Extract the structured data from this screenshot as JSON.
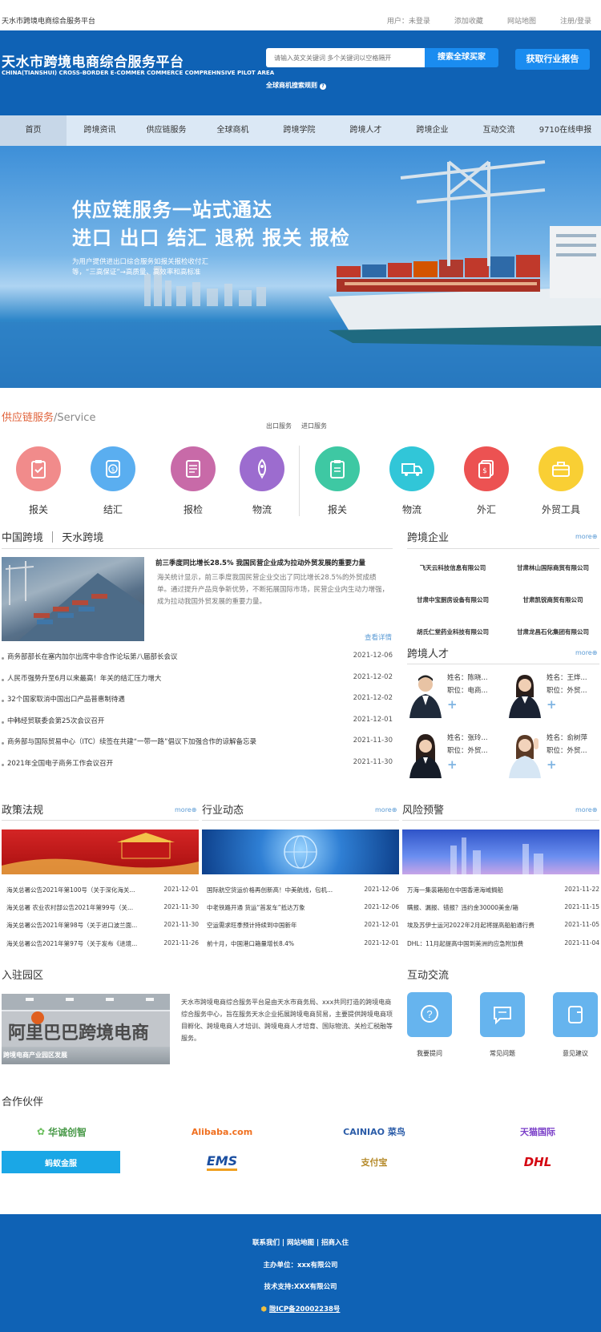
{
  "topbar": {
    "site_name": "天水市跨境电商综合服务平台",
    "links": [
      "用户：未登录",
      "添加收藏",
      "网站地图",
      "注册/登录"
    ]
  },
  "header": {
    "title": "天水市跨境电商综合服务平台",
    "subtitle": "CHINA(TIANSHUI) CROSS-BORDER E-COMMER COMMERCE COMPREHNSIVE PILOT AREA",
    "search_placeholder": "请输入英文关键词 多个关键词以空格隔开",
    "search_button": "搜索全球买家",
    "report_button": "获取行业报告",
    "search_rules": "全球商机搜索规则"
  },
  "nav": [
    "首页",
    "跨境资讯",
    "供应链服务",
    "全球商机",
    "跨境学院",
    "跨境人才",
    "跨境企业",
    "互动交流",
    "9710在线申报"
  ],
  "banner": {
    "title1": "供应链服务一站式通达",
    "title2": "进口 出口 结汇 退税 报关 报检",
    "subtitle": "为用户提供进出口综合服务如报关报检收付汇等，“三高保证”→高质量、高效率和高标准"
  },
  "service": {
    "title": "供应链服务",
    "title_en": "/Service",
    "tabs": [
      "出口服务",
      "进口服务"
    ],
    "items": [
      {
        "label": "报关",
        "color": "#f18b8b",
        "icon": "clipboard-icon"
      },
      {
        "label": "结汇",
        "color": "#5aaef0",
        "icon": "coin-icon"
      },
      {
        "label": "报检",
        "color": "#c86aa8",
        "icon": "document-icon"
      },
      {
        "label": "物流",
        "color": "#9c6ccf",
        "icon": "rocket-icon"
      },
      {
        "label": "报关",
        "color": "#3ec8a3",
        "icon": "clipboard-icon"
      },
      {
        "label": "物流",
        "color": "#31c6d8",
        "icon": "truck-icon"
      },
      {
        "label": "外汇",
        "color": "#ec5252",
        "icon": "money-icon"
      },
      {
        "label": "外贸工具",
        "color": "#f9cf34",
        "icon": "toolbox-icon"
      }
    ]
  },
  "news": {
    "tab1": "中国跨境",
    "tab2": "天水跨境",
    "headline": "前三季度同比增长28.5% 我国民营企业成为拉动外贸发展的重要力量",
    "summary": "海关统计显示，前三季度我国民营企业交出了同比增长28.5%的外贸成绩单。通过提升产品竞争新优势，不断拓展国际市场，民营企业内生动力增强，成为拉动我国外贸发展的重要力量。",
    "detail": "查看详情",
    "items": [
      {
        "title": "商务部部长在塞内加尔出席中非合作论坛第八届部长会议",
        "date": "2021-12-06"
      },
      {
        "title": "人民币强势升至6月以来最高！年关的结汇压力增大",
        "date": "2021-12-02"
      },
      {
        "title": "32个国家取消中国出口产品普惠制待遇",
        "date": "2021-12-02"
      },
      {
        "title": "中韩经贸联委会第25次会议召开",
        "date": "2021-12-01"
      },
      {
        "title": "商务部与国际贸易中心（ITC）续签在共建“一带一路”倡议下加强合作的谅解备忘录",
        "date": "2021-11-30"
      },
      {
        "title": "2021年全国电子商务工作会议召开",
        "date": "2021-11-30"
      }
    ]
  },
  "enterprise": {
    "title": "跨境企业",
    "more": "more",
    "items": [
      "飞天云科技信息有限公司",
      "甘肃林山国际商贸有限公司",
      "甘肃中宝厨房设备有限公司",
      "甘肃凯锐商贸有限公司",
      "胡氏仁堂药业科技有限公司",
      "甘肃龙昌石化集团有限公司"
    ]
  },
  "talent": {
    "title": "跨境人才",
    "more": "more",
    "items": [
      {
        "name": "姓名：陈晓...",
        "job": "职位：电商..."
      },
      {
        "name": "姓名：王烨...",
        "job": "职位：外贸..."
      },
      {
        "name": "姓名：张玲...",
        "job": "职位：外贸..."
      },
      {
        "name": "姓名：俞树萍",
        "job": "职位：外贸..."
      }
    ]
  },
  "policy": {
    "title": "政策法规",
    "more": "more",
    "items": [
      {
        "title": "海关总署公告2021年第100号（关于深化海关...",
        "date": "2021-12-01"
      },
      {
        "title": "海关总署 农业农村部公告2021年第99号（关...",
        "date": "2021-11-30"
      },
      {
        "title": "海关总署公告2021年第98号（关于进口波兰面...",
        "date": "2021-11-30"
      },
      {
        "title": "海关总署公告2021年第97号（关于发布《进境...",
        "date": "2021-11-26"
      }
    ]
  },
  "industry": {
    "title": "行业动态",
    "more": "more",
    "items": [
      {
        "title": "国际航空货运价格再创新高！中美航线，包机...",
        "date": "2021-12-06"
      },
      {
        "title": "中老铁路开通 货运“首发车”抵达万象",
        "date": "2021-12-06"
      },
      {
        "title": "空运需求旺季预计持续到中国新年",
        "date": "2021-12-01"
      },
      {
        "title": "前十月，中国港口箱量增长8.4%",
        "date": "2021-12-01"
      }
    ]
  },
  "risk": {
    "title": "风险预警",
    "more": "more",
    "items": [
      {
        "title": "万海一集装箱船在中国香港海域搁船",
        "date": "2021-11-22"
      },
      {
        "title": "瞒报、漏报、错报？违约金30000美金/箱",
        "date": "2021-11-15"
      },
      {
        "title": "埃及苏伊士运河2022年2月起将提高船舶通行费",
        "date": "2021-11-05"
      },
      {
        "title": "DHL：11月起提高中国到美洲的应急附加费",
        "date": "2021-11-04"
      }
    ]
  },
  "park": {
    "title": "入驻园区",
    "caption": "跨境电商产业园区发展",
    "text": "天水市跨境电商综合服务平台是由天水市商务局、xxx共同打造的跨境电商综合服务中心，旨在服务天水企业拓展跨境电商贸易，主要提供跨境电商项目孵化、跨境电商人才培训、跨境电商人才培育、国际物流、关检汇税融等服务。"
  },
  "interaction": {
    "title": "互动交流",
    "items": [
      {
        "label": "我要提问",
        "icon": "question-icon"
      },
      {
        "label": "常见问题",
        "icon": "chat-edit-icon"
      },
      {
        "label": "意见建议",
        "icon": "feedback-icon"
      }
    ]
  },
  "partners": {
    "title": "合作伙伴",
    "items": [
      {
        "name": "华诚创智",
        "color": "#4a9a4a"
      },
      {
        "name": "Alibaba.com",
        "color": "#f07020"
      },
      {
        "name": "CAINIAO 菜鸟",
        "color": "#2b5ca8"
      },
      {
        "name": "天猫国际",
        "color": "#7a3ec8"
      },
      {
        "name": "蚂蚁金服",
        "color": "#ffffff"
      },
      {
        "name": "EMS",
        "color": "#1a4ea0"
      },
      {
        "name": "支付宝",
        "color": "#b58a2a"
      },
      {
        "name": "DHL",
        "color": "#d40511"
      }
    ]
  },
  "footer": {
    "links": "联系我们 | 网站地图 | 招商入住",
    "host": "主办单位：xxx有限公司",
    "tech": "技术支持:XXX有限公司",
    "icp": "陇ICP备20002238号"
  }
}
